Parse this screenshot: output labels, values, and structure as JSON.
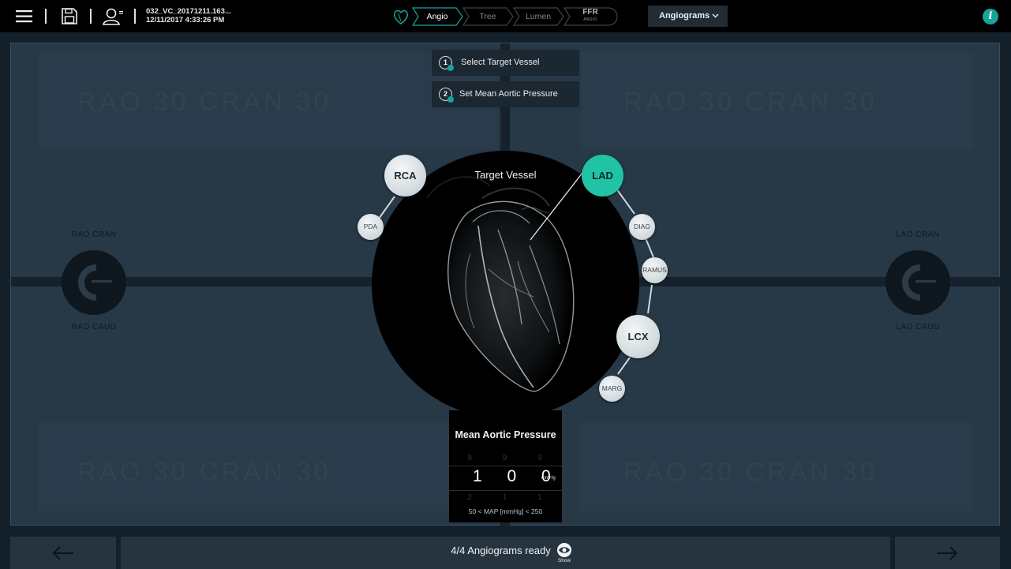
{
  "header": {
    "menu_icon": "hamburger-menu-icon",
    "save_icon": "save-disk-icon",
    "patient_icon": "patient-profile-icon",
    "case_id": "032_VC_20171211.163...",
    "case_datetime": "12/11/2017 4:33:26 PM",
    "workflow_icon": "heart-outline-icon",
    "steps": [
      {
        "label": "Angio",
        "state": "active"
      },
      {
        "label": "Tree",
        "state": "inactive"
      },
      {
        "label": "Lumen",
        "state": "inactive"
      },
      {
        "label": "FFR",
        "sublabel": "ANGIO",
        "state": "inactive"
      }
    ],
    "angiograms_dropdown": "Angiograms",
    "info_button": "i",
    "accent_color": "#1aa39a"
  },
  "workspace": {
    "ghost_labels": [
      "RAO 30 CRAN 30",
      "RAO 30 CRAN 30",
      "RAO 30 CRAN 30",
      "RAO 30 CRAN 30"
    ],
    "left_arm": {
      "top_label": "RAO CRAN",
      "bottom_label": "RAO CAUD"
    },
    "right_arm": {
      "top_label": "LAO CRAN",
      "bottom_label": "LAO CAUD"
    },
    "instructions": [
      {
        "number": "1",
        "text": "Select Target Vessel"
      },
      {
        "number": "2",
        "text": "Set Mean Aortic Pressure"
      }
    ],
    "target_vessel": {
      "title": "Target Vessel",
      "selected": "LAD",
      "vessels": {
        "rca": "RCA",
        "pda": "PDA",
        "lad": "LAD",
        "diag": "DIAG",
        "ramus": "RAMUS",
        "lcx": "LCX",
        "marg": "MARG"
      },
      "selected_color": "#20c4a5"
    },
    "pressure": {
      "title": "Mean Aortic Pressure",
      "above_digits": "9 9 9",
      "value_digits": "1 0 0",
      "below_digits": "2 1 1",
      "unit": "mmHg",
      "range": "50 < MAP [mmHg] < 250"
    }
  },
  "footer": {
    "back_icon": "arrow-left-icon",
    "forward_icon": "arrow-right-icon",
    "status": "4/4 Angiograms ready",
    "show_icon": "eye-icon",
    "show_label": "Show"
  }
}
